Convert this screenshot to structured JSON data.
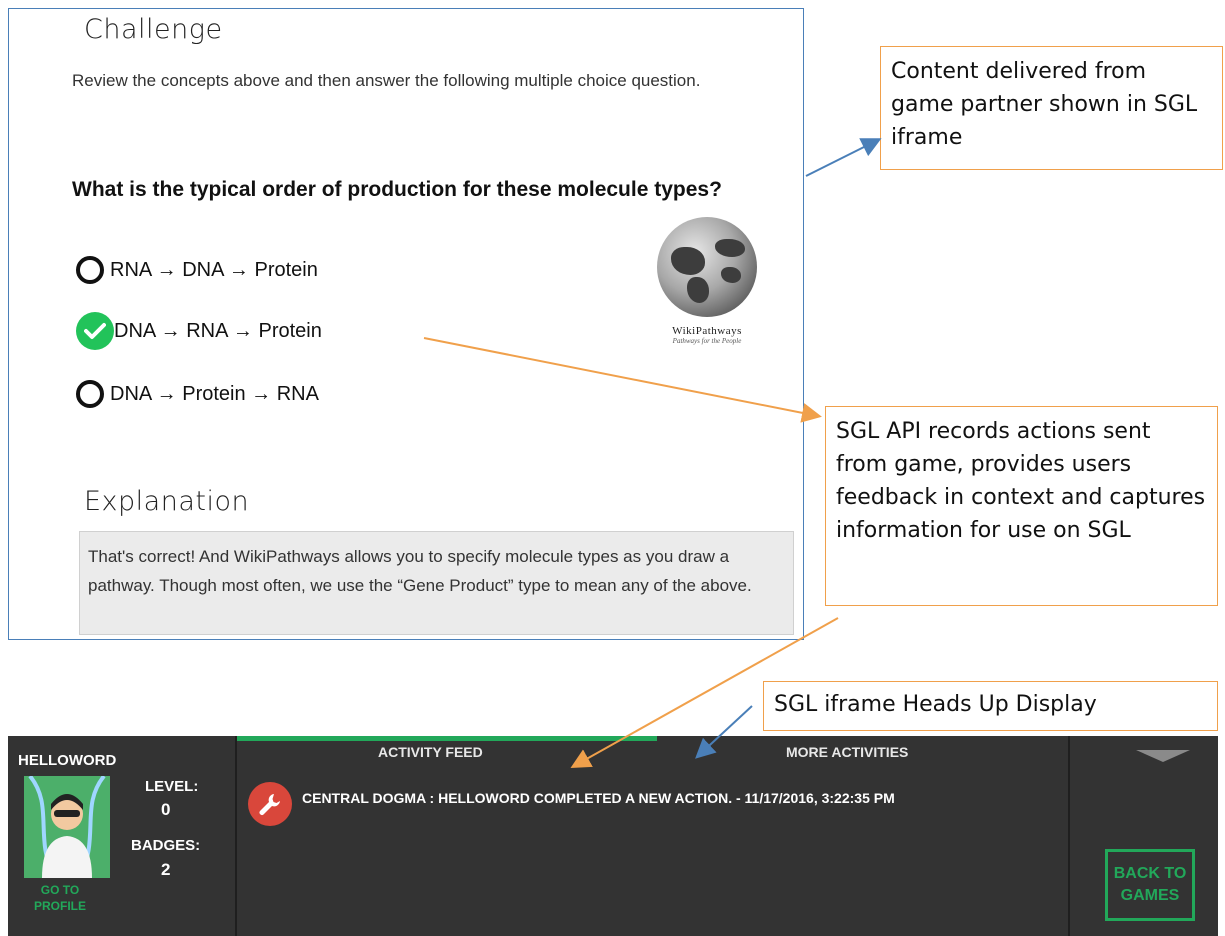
{
  "challenge": {
    "heading": "Challenge",
    "intro": "Review the concepts above and then answer the following multiple choice question.",
    "question": "What is the typical order of production for these molecule types?",
    "choices": [
      {
        "label": "RNA → DNA → Protein",
        "state": "unselected"
      },
      {
        "label": "DNA → RNA → Protein",
        "state": "correct"
      },
      {
        "label": "DNA → Protein → RNA",
        "state": "unselected"
      }
    ]
  },
  "logo": {
    "name": "WikiPathways",
    "tagline": "Pathways for the People"
  },
  "explanation": {
    "heading": "Explanation",
    "text": "That's correct! And WikiPathways allows you to specify molecule types as you draw a pathway. Though most often, we use the “Gene Product” type to mean any of the above."
  },
  "annotations": {
    "iframe_note": "Content delivered from game partner shown in SGL iframe",
    "api_note": "SGL API records actions sent from game,  provides users feedback in context and captures information for use on SGL",
    "hud_note": "SGL iframe Heads Up Display"
  },
  "hud": {
    "username": "HELLOWORD",
    "level_label": "LEVEL:",
    "level_value": "0",
    "badges_label": "BADGES:",
    "badges_value": "2",
    "profile_link": "GO TO PROFILE",
    "tabs": [
      "ACTIVITY FEED",
      "MORE ACTIVITIES"
    ],
    "active_tab": "ACTIVITY FEED",
    "feed_item": "CENTRAL DOGMA : HELLOWORD COMPLETED A NEW ACTION. - 11/17/2016, 3:22:35 PM",
    "feed_icon": "wrench-icon",
    "back_button": "BACK TO GAMES"
  },
  "colors": {
    "frame_border": "#4a7fb8",
    "annotation_border": "#f0a04b",
    "hud_background": "#333333",
    "accent_green": "#22a85a",
    "correct_check": "#22c35a",
    "feed_icon_bg": "#d9473b"
  }
}
